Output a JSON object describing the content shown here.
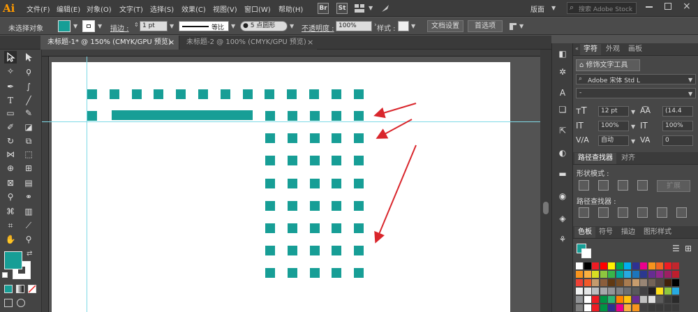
{
  "app": {
    "logo": "Ai"
  },
  "menu": {
    "items": [
      "文件(F)",
      "编辑(E)",
      "对象(O)",
      "文字(T)",
      "选择(S)",
      "效果(C)",
      "视图(V)",
      "窗口(W)",
      "帮助(H)"
    ]
  },
  "topbar": {
    "bridge": "Br",
    "stock": "St",
    "workspace": "版面",
    "search_placeholder": "搜索 Adobe Stock"
  },
  "control": {
    "selection": "未选择对象",
    "stroke_label": "描边 :",
    "stroke_value": "1 pt",
    "profile_label": "等比",
    "brush_label": "● 5 点圆形",
    "opacity_label": "不透明度 :",
    "opacity_value": "100%",
    "style_label": "样式 :",
    "doc_setup": "文档设置",
    "prefs": "首选项"
  },
  "tabs": [
    {
      "label": "未标题-1* @ 150% (CMYK/GPU 预览)",
      "close": "×"
    },
    {
      "label": "未标题-2 @ 100% (CMYK/GPU 预览)",
      "close": "×"
    }
  ],
  "colors": {
    "teal": "#179e96",
    "arrow": "#d9262c"
  },
  "artwork": {
    "top_row_count": 13,
    "second_row_left_squares": 1,
    "second_row_bar_fraction_of_row": 0.4,
    "grid_columns": 5,
    "grid_rows": 8
  },
  "panel_char": {
    "tabs": [
      "字符",
      "外观",
      "画板"
    ],
    "touch_tool": "修饰文字工具",
    "font": "Adobe 宋体 Std L",
    "style": "-",
    "size": "12 pt",
    "leading": "(14.4",
    "vscale": "100%",
    "hscale": "100%",
    "kerning": "自动",
    "tracking": "0"
  },
  "panel_path": {
    "tabs": [
      "路径查找器",
      "对齐"
    ],
    "shape_modes": "形状模式 :",
    "expand": "扩展",
    "pathfinders": "路径查找器 :"
  },
  "panel_swatch": {
    "tabs": [
      "色板",
      "符号",
      "描边",
      "图形样式"
    ]
  }
}
